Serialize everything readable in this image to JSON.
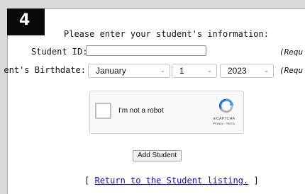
{
  "step": {
    "number": "4"
  },
  "form": {
    "intro": "Please enter your student's information:",
    "student_id": {
      "label": "Student ID:",
      "value": "",
      "required_note": "(Requ"
    },
    "birthdate": {
      "label": "ent's Birthdate:",
      "month": "January",
      "day": "1",
      "year": "2023",
      "required_note": "(Requ"
    }
  },
  "captcha": {
    "checkbox_label": "I'm not a robot",
    "brand": "reCAPTCHA",
    "links": "Privacy - Terms"
  },
  "actions": {
    "add_button": "Add Student"
  },
  "footer": {
    "bracket_open": "[",
    "link_text": "Return to the Student listing.",
    "bracket_close": "]"
  },
  "colors": {
    "badge_bg": "#0a0a0a",
    "link": "#1a0dab",
    "recaptcha_blue": "#4a90e2",
    "recaptcha_grey": "#b3b3b3"
  }
}
